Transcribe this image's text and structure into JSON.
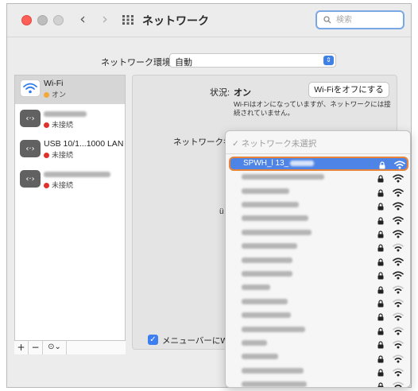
{
  "window": {
    "title": "ネットワーク"
  },
  "search": {
    "placeholder": "検索"
  },
  "location": {
    "label": "ネットワーク環境:",
    "value": "自動"
  },
  "sidebar": {
    "services": [
      {
        "name": "Wi-Fi",
        "status": "オン",
        "status_color": "#f2a93b",
        "icon": "wifi-icon",
        "selected": true
      },
      {
        "name": "",
        "name_obscured": true,
        "status": "未接続",
        "status_color": "#e0322a",
        "icon": "ethernet-icon"
      },
      {
        "name": "USB 10/1...1000 LAN",
        "status": "未接続",
        "status_color": "#e0322a",
        "icon": "ethernet-icon"
      },
      {
        "name": "",
        "name_obscured": true,
        "status": "未接続",
        "status_color": "#e0322a",
        "icon": "ethernet-icon"
      }
    ],
    "tools": {
      "add": "+",
      "remove": "−",
      "more": "⊙⌄"
    }
  },
  "detail": {
    "status_label": "状況:",
    "status_value": "オン",
    "wifi_off_button": "Wi-Fiをオフにする",
    "status_description": "Wi-Fiはオンになっていますが、ネットワークには接続されていません。",
    "network_name_label": "ネットワーク名",
    "side_char": "ü",
    "menubar_checkbox_label": "メニューバーにWi",
    "menubar_checked": true
  },
  "dropdown": {
    "header": "✓ ネットワーク未選択",
    "networks": [
      {
        "name": "SPWH_l 13_",
        "selected": true,
        "locked": true,
        "signal": 3
      },
      {
        "name": "",
        "locked": true,
        "signal": 3
      },
      {
        "name": "",
        "locked": true,
        "signal": 3
      },
      {
        "name": "",
        "locked": true,
        "signal": 3
      },
      {
        "name": "",
        "locked": true,
        "signal": 3
      },
      {
        "name": "",
        "locked": true,
        "signal": 3
      },
      {
        "name": "",
        "locked": true,
        "signal": 2
      },
      {
        "name": "",
        "locked": true,
        "signal": 3
      },
      {
        "name": "",
        "locked": true,
        "signal": 3
      },
      {
        "name": "",
        "locked": true,
        "signal": 2
      },
      {
        "name": "",
        "locked": true,
        "signal": 2
      },
      {
        "name": "",
        "locked": true,
        "signal": 2
      },
      {
        "name": "",
        "locked": true,
        "signal": 2
      },
      {
        "name": "",
        "locked": true,
        "signal": 2
      },
      {
        "name": "",
        "locked": true,
        "signal": 2
      },
      {
        "name": "",
        "locked": true,
        "signal": 2
      },
      {
        "name": "",
        "locked": true,
        "signal": 2
      },
      {
        "name": "",
        "locked": true,
        "signal": 2
      }
    ]
  },
  "colors": {
    "accent": "#4e84e6",
    "highlight_outline": "#e8843a",
    "status_on": "#f2a93b",
    "status_off": "#e0322a"
  }
}
